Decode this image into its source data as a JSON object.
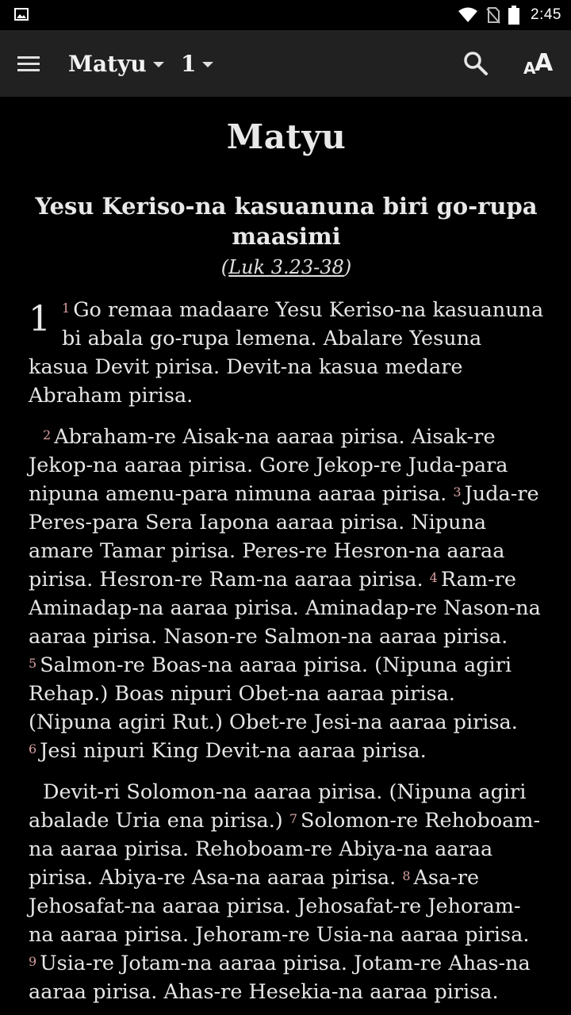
{
  "status_bar": {
    "time": "2:45"
  },
  "app_bar": {
    "book": "Matyu",
    "chapter": "1"
  },
  "content": {
    "book_title": "Matyu",
    "section_heading": "Yesu Keriso-na kasuanuna biri go-rupa maasimi",
    "cross_reference": "Luk 3.23-38",
    "chapter_number": "1",
    "paragraphs": [
      [
        {
          "n": "1",
          "t": "Go remaa madaare Yesu Keriso-na kasuanuna bi abala go-rupa lemena. Abalare Yesuna kasua Devit pirisa. Devit-na kasua medare Abraham pirisa."
        }
      ],
      [
        {
          "n": "2",
          "t": "Abraham-re Aisak-na aaraa pirisa. Aisak-re Jekop-na aaraa pirisa. Gore Jekop-re Juda-para nipuna amenu-para nimuna aaraa pirisa. "
        },
        {
          "n": "3",
          "t": "Juda-re Peres-para Sera Iapona aaraa pirisa. Nipuna amare Tamar pirisa. Peres-re Hesron-na aaraa pirisa. Hesron-re Ram-na aaraa pirisa. "
        },
        {
          "n": "4",
          "t": "Ram-re Aminadap-na aaraa pirisa. Aminadap-re Nason-na aaraa pirisa. Nason-re Salmon-na aaraa pirisa. "
        },
        {
          "n": "5",
          "t": "Salmon-re Boas-na aaraa pirisa. (Nipuna agiri Rehap.) Boas nipuri Obet-na aaraa pirisa. (Nipuna agiri Rut.) Obet-re Jesi-na aaraa pirisa. "
        },
        {
          "n": "6",
          "t": "Jesi nipuri King Devit-na aaraa pirisa."
        }
      ],
      [
        {
          "n": "",
          "t": "Devit-ri Solomon-na aaraa pirisa. (Nipuna agiri abalade Uria ena pirisa.) "
        },
        {
          "n": "7",
          "t": "Solomon-re Rehoboam-na aaraa pirisa. Rehoboam-re Abiya-na aaraa pirisa. Abiya-re Asa-na aaraa pirisa. "
        },
        {
          "n": "8",
          "t": "Asa-re Jehosafat-na aaraa pirisa. Jehosafat-re Jehoram-na aaraa pirisa. Jehoram-re Usia-na aaraa pirisa. "
        },
        {
          "n": "9",
          "t": "Usia-re Jotam-na aaraa pirisa. Jotam-re Ahas-na aaraa pirisa. Ahas-re Hesekia-na aaraa pirisa."
        }
      ]
    ]
  }
}
